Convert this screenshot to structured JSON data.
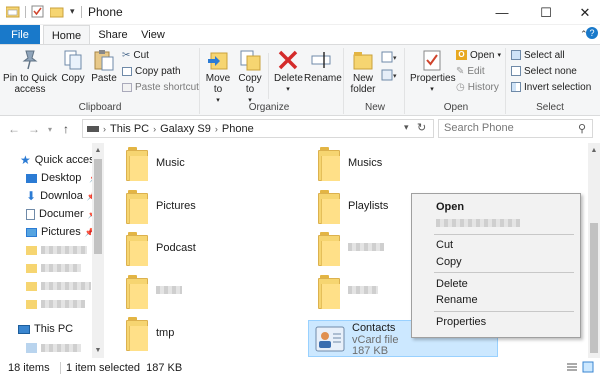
{
  "window": {
    "title": "Phone",
    "minimize": "—",
    "maximize": "☐",
    "close": "✕"
  },
  "ribbon_tabs": {
    "file": "File",
    "home": "Home",
    "share": "Share",
    "view": "View"
  },
  "ribbon": {
    "clipboard": {
      "label": "Clipboard",
      "pin": "Pin to Quick access",
      "copy": "Copy",
      "paste": "Paste",
      "cut": "Cut",
      "copy_path": "Copy path",
      "paste_shortcut": "Paste shortcut"
    },
    "organize": {
      "label": "Organize",
      "move_to": "Move to",
      "copy_to": "Copy to",
      "delete": "Delete",
      "rename": "Rename"
    },
    "new": {
      "label": "New",
      "new_folder": "New folder"
    },
    "open": {
      "label": "Open",
      "properties": "Properties",
      "open": "Open",
      "edit": "Edit",
      "history": "History"
    },
    "select": {
      "label": "Select",
      "select_all": "Select all",
      "select_none": "Select none",
      "invert": "Invert selection"
    }
  },
  "address": {
    "crumbs": [
      "This PC",
      "Galaxy S9",
      "Phone"
    ],
    "search_placeholder": "Search Phone"
  },
  "nav": {
    "quick_access": "Quick access",
    "desktop": "Desktop",
    "downloads": "Downloa",
    "documents": "Documer",
    "pictures": "Pictures",
    "this_pc": "This PC"
  },
  "files": {
    "music": "Music",
    "musics": "Musics",
    "pictures": "Pictures",
    "playlists": "Playlists",
    "podcast": "Podcast",
    "tmp": "tmp",
    "contacts_name": "Contacts",
    "contacts_type": "vCard file",
    "contacts_size": "187 KB"
  },
  "context_menu": {
    "open": "Open",
    "cut": "Cut",
    "copy": "Copy",
    "delete": "Delete",
    "rename": "Rename",
    "properties": "Properties"
  },
  "status": {
    "items": "18 items",
    "selected": "1 item selected  187 KB"
  },
  "colors": {
    "accent": "#1979ca",
    "selection": "#cce8ff",
    "folder": "#f6d571"
  }
}
